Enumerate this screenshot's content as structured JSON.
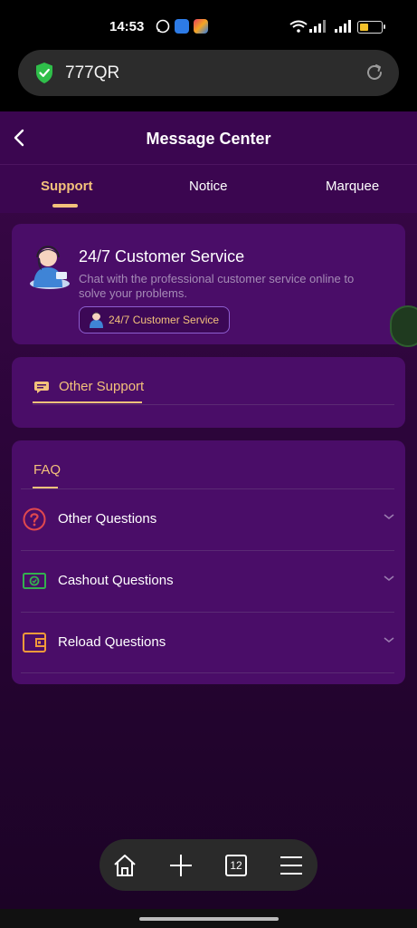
{
  "status_bar": {
    "time": "14:53"
  },
  "browser": {
    "url": "777QR",
    "tab_count": "12"
  },
  "header": {
    "title": "Message Center"
  },
  "tabs": [
    {
      "label": "Support",
      "active": true
    },
    {
      "label": "Notice",
      "active": false
    },
    {
      "label": "Marquee",
      "active": false
    }
  ],
  "customer_service": {
    "title": "24/7 Customer Service",
    "description": "Chat with the professional customer service online to solve your problems.",
    "button_label": "24/7 Customer Service"
  },
  "other_support": {
    "tab_label": "Other Support"
  },
  "faq": {
    "tab_label": "FAQ",
    "items": [
      {
        "label": "Other Questions",
        "icon": "question-circle-icon"
      },
      {
        "label": "Cashout Questions",
        "icon": "cash-icon"
      },
      {
        "label": "Reload Questions",
        "icon": "wallet-icon"
      }
    ]
  },
  "colors": {
    "accent": "#f3c17b",
    "card": "#4a0d68",
    "header": "#3b0650",
    "button_border": "#8e5ed0",
    "icon_red": "#e0484e",
    "icon_green": "#34b04f",
    "icon_orange": "#f29a3a",
    "shield_green": "#2fbf4a"
  },
  "icons": {
    "back": "chevron-left-icon",
    "shield": "shield-icon",
    "reload": "reload-icon",
    "home": "home-icon",
    "add": "plus-icon",
    "tabs": "tabs-icon",
    "menu": "menu-icon",
    "chevron": "chevron-down-icon"
  }
}
